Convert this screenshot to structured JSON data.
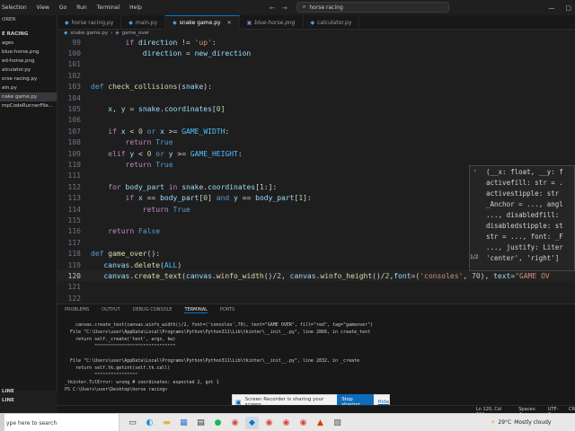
{
  "window": {
    "menu": [
      "Selection",
      "View",
      "Go",
      "Run",
      "Terminal",
      "Help"
    ],
    "search": "horse racing"
  },
  "sidebar": {
    "header": "ORER",
    "project": "E RACING",
    "files": [
      {
        "label": "ages",
        "active": false
      },
      {
        "label": "blue-horse.png",
        "active": false
      },
      {
        "label": "ed-horse.png",
        "active": false
      },
      {
        "label": "alculator.py",
        "active": false
      },
      {
        "label": "orse racing.py",
        "active": false
      },
      {
        "label": "ain.py",
        "active": false
      },
      {
        "label": "nake game.py",
        "active": true
      },
      {
        "label": "mpCodeRunnerFile...",
        "active": false
      }
    ],
    "bottom_sections": [
      "LINE",
      "LINE"
    ]
  },
  "tabs": [
    {
      "label": "horse racing.py",
      "type": "py",
      "active": false,
      "italic": false
    },
    {
      "label": "main.py",
      "type": "py",
      "active": false,
      "italic": false
    },
    {
      "label": "snake game.py",
      "type": "py",
      "active": true,
      "italic": false
    },
    {
      "label": "blue-horse.png",
      "type": "png",
      "active": false,
      "italic": true
    },
    {
      "label": "calculator.py",
      "type": "py",
      "active": false,
      "italic": false
    }
  ],
  "breadcrumb": {
    "file": "snake game.py",
    "symbol": "game_over"
  },
  "editor": {
    "lines": [
      {
        "n": "99",
        "tokens": [
          [
            "        ",
            ""
          ],
          [
            "if",
            "kw"
          ],
          [
            " ",
            ""
          ],
          [
            "direction",
            "var"
          ],
          [
            " != ",
            ""
          ],
          [
            "'up'",
            "str"
          ],
          [
            ":",
            ""
          ]
        ]
      },
      {
        "n": "100",
        "tokens": [
          [
            "            ",
            ""
          ],
          [
            "direction",
            "var"
          ],
          [
            " = ",
            ""
          ],
          [
            "new_direction",
            "var"
          ]
        ]
      },
      {
        "n": "101",
        "tokens": []
      },
      {
        "n": "102",
        "tokens": []
      },
      {
        "n": "103",
        "tokens": [
          [
            "def",
            "def"
          ],
          [
            " ",
            ""
          ],
          [
            "check_collisions",
            "fn"
          ],
          [
            "(",
            ""
          ],
          [
            "snake",
            "param"
          ],
          [
            "):",
            ""
          ]
        ]
      },
      {
        "n": "104",
        "tokens": []
      },
      {
        "n": "105",
        "tokens": [
          [
            "    ",
            ""
          ],
          [
            "x",
            "var"
          ],
          [
            ", ",
            ""
          ],
          [
            "y",
            "var"
          ],
          [
            " = ",
            ""
          ],
          [
            "snake",
            "var"
          ],
          [
            ".",
            ""
          ],
          [
            "coordinates",
            "var"
          ],
          [
            "[",
            ""
          ],
          [
            "0",
            "num"
          ],
          [
            "]",
            ""
          ]
        ]
      },
      {
        "n": "106",
        "tokens": []
      },
      {
        "n": "107",
        "tokens": [
          [
            "    ",
            ""
          ],
          [
            "if",
            "kw"
          ],
          [
            " ",
            ""
          ],
          [
            "x",
            "var"
          ],
          [
            " < ",
            ""
          ],
          [
            "0",
            "num"
          ],
          [
            " ",
            ""
          ],
          [
            "or",
            "def"
          ],
          [
            " ",
            ""
          ],
          [
            "x",
            "var"
          ],
          [
            " >= ",
            ""
          ],
          [
            "GAME_WIDTH",
            "const"
          ],
          [
            ":",
            ""
          ]
        ]
      },
      {
        "n": "108",
        "tokens": [
          [
            "        ",
            ""
          ],
          [
            "return",
            "kw"
          ],
          [
            " ",
            ""
          ],
          [
            "True",
            "bool"
          ]
        ]
      },
      {
        "n": "109",
        "tokens": [
          [
            "    ",
            ""
          ],
          [
            "elif",
            "kw"
          ],
          [
            " ",
            ""
          ],
          [
            "y",
            "var"
          ],
          [
            " < ",
            ""
          ],
          [
            "0",
            "num"
          ],
          [
            " ",
            ""
          ],
          [
            "or",
            "def"
          ],
          [
            " ",
            ""
          ],
          [
            "y",
            "var"
          ],
          [
            " >= ",
            ""
          ],
          [
            "GAME_HEIGHT",
            "const"
          ],
          [
            ":",
            ""
          ]
        ]
      },
      {
        "n": "110",
        "tokens": [
          [
            "        ",
            ""
          ],
          [
            "return",
            "kw"
          ],
          [
            " ",
            ""
          ],
          [
            "True",
            "bool"
          ]
        ]
      },
      {
        "n": "111",
        "tokens": []
      },
      {
        "n": "112",
        "tokens": [
          [
            "    ",
            ""
          ],
          [
            "for",
            "kw"
          ],
          [
            " ",
            ""
          ],
          [
            "body_part",
            "var"
          ],
          [
            " ",
            ""
          ],
          [
            "in",
            "kw"
          ],
          [
            " ",
            ""
          ],
          [
            "snake",
            "var"
          ],
          [
            ".",
            ""
          ],
          [
            "coordinates",
            "var"
          ],
          [
            "[",
            ""
          ],
          [
            "1",
            "num"
          ],
          [
            ":]:",
            ""
          ]
        ]
      },
      {
        "n": "113",
        "tokens": [
          [
            "        ",
            ""
          ],
          [
            "if",
            "kw"
          ],
          [
            " ",
            ""
          ],
          [
            "x",
            "var"
          ],
          [
            " == ",
            ""
          ],
          [
            "body_part",
            "var"
          ],
          [
            "[",
            ""
          ],
          [
            "0",
            "num"
          ],
          [
            "] ",
            ""
          ],
          [
            "and",
            "def"
          ],
          [
            " ",
            ""
          ],
          [
            "y",
            "var"
          ],
          [
            " == ",
            ""
          ],
          [
            "body_part",
            "var"
          ],
          [
            "[",
            ""
          ],
          [
            "1",
            "num"
          ],
          [
            "]:",
            ""
          ]
        ]
      },
      {
        "n": "114",
        "tokens": [
          [
            "            ",
            ""
          ],
          [
            "return",
            "kw"
          ],
          [
            " ",
            ""
          ],
          [
            "True",
            "bool"
          ]
        ]
      },
      {
        "n": "115",
        "tokens": []
      },
      {
        "n": "116",
        "tokens": [
          [
            "    ",
            ""
          ],
          [
            "return",
            "kw"
          ],
          [
            " ",
            ""
          ],
          [
            "False",
            "bool"
          ]
        ]
      },
      {
        "n": "117",
        "tokens": []
      },
      {
        "n": "118",
        "tokens": [
          [
            "def",
            "def"
          ],
          [
            " ",
            ""
          ],
          [
            "game_over",
            "fn"
          ],
          [
            "():",
            ""
          ]
        ]
      },
      {
        "n": "119",
        "tokens": [
          [
            "   ",
            ""
          ],
          [
            "canvas",
            "var"
          ],
          [
            ".",
            ""
          ],
          [
            "delete",
            "fn"
          ],
          [
            "(",
            ""
          ],
          [
            "ALL",
            "const"
          ],
          [
            ")",
            ""
          ]
        ]
      },
      {
        "n": "120",
        "tokens": [
          [
            "   ",
            ""
          ],
          [
            "canvas",
            "var"
          ],
          [
            ".",
            ""
          ],
          [
            "create_text",
            "fn"
          ],
          [
            "(",
            ""
          ],
          [
            "canvas",
            "var"
          ],
          [
            ".",
            ""
          ],
          [
            "winfo_width",
            "fn"
          ],
          [
            "()/",
            ""
          ],
          [
            "2",
            "num"
          ],
          [
            ", ",
            ""
          ],
          [
            "canvas",
            "var"
          ],
          [
            ".",
            ""
          ],
          [
            "winfo_height",
            "fn"
          ],
          [
            "()/",
            ""
          ],
          [
            "2",
            "num"
          ],
          [
            ",",
            ""
          ],
          [
            "font",
            "var"
          ],
          [
            "=(",
            ""
          ],
          [
            "'consoles'",
            "str"
          ],
          [
            ", ",
            ""
          ],
          [
            "70",
            "num"
          ],
          [
            "), ",
            ""
          ],
          [
            "text",
            "var"
          ],
          [
            "=",
            ""
          ],
          [
            "\"GAME OV",
            "str"
          ]
        ],
        "current": true
      },
      {
        "n": "121",
        "tokens": []
      },
      {
        "n": "122",
        "tokens": []
      }
    ]
  },
  "hover": {
    "lines": [
      "(__x: float, __y: f",
      "activefill: str = .",
      "activestipple: str",
      "_Anchor = ..., angl",
      "..., disabledfill:",
      "disabledstipple: st",
      "str = ..., font: _F",
      "..., justify: Liter",
      "'center', 'right']"
    ],
    "counter": "1/2"
  },
  "panel": {
    "tabs": [
      "PROBLEMS",
      "OUTPUT",
      "DEBUG CONSOLE",
      "TERMINAL",
      "PORTS"
    ],
    "active_tab": "TERMINAL",
    "terminal": [
      "    canvas.create_text(canvas.winfo_width()/2, font=('consoles',70), text=\"GAME OVER\", fill=\"red\", tag=\"gameover\")",
      "  File \"C:\\Users\\user\\AppData\\Local\\Programs\\Python\\Python311\\Lib\\tkinter\\__init__.py\", line 2866, in create_text",
      "    return self._create('text', args, kw)",
      "           ^^^^^^^^^^^^^^^^^^^^^^^^^^^^^^",
      "",
      "  File \"C:\\Users\\user\\AppData\\Local\\Programs\\Python\\Python311\\Lib\\tkinter\\__init__.py\", line 2832, in _create",
      "    return self.tk.getint(self.tk.call(",
      "           ^^^^^^^^^^^^^^^^",
      "_tkinter.TclError: wrong # coordinates: expected 2, got 1",
      "PS C:\\Users\\user\\Desktop\\horse racing>"
    ]
  },
  "sharebar": {
    "message": "Screen Recorder is sharing your screen.",
    "stop_label": "Stop sharing",
    "hide_label": "Hide"
  },
  "statusbar": {
    "items": [
      "Ln 120, Col 111",
      "Spaces: 4",
      "UTF-8",
      "CR"
    ]
  },
  "taskbar": {
    "search_placeholder": "ype here to search",
    "weather_temp": "29°C",
    "weather_text": "Mostly cloudy"
  },
  "colors": {
    "accent": "#0078d4",
    "editor_bg": "#1e1e1e",
    "keyword": "#c586c0",
    "function": "#dcdcaa",
    "string": "#ce9178",
    "constant": "#4fc1ff"
  }
}
